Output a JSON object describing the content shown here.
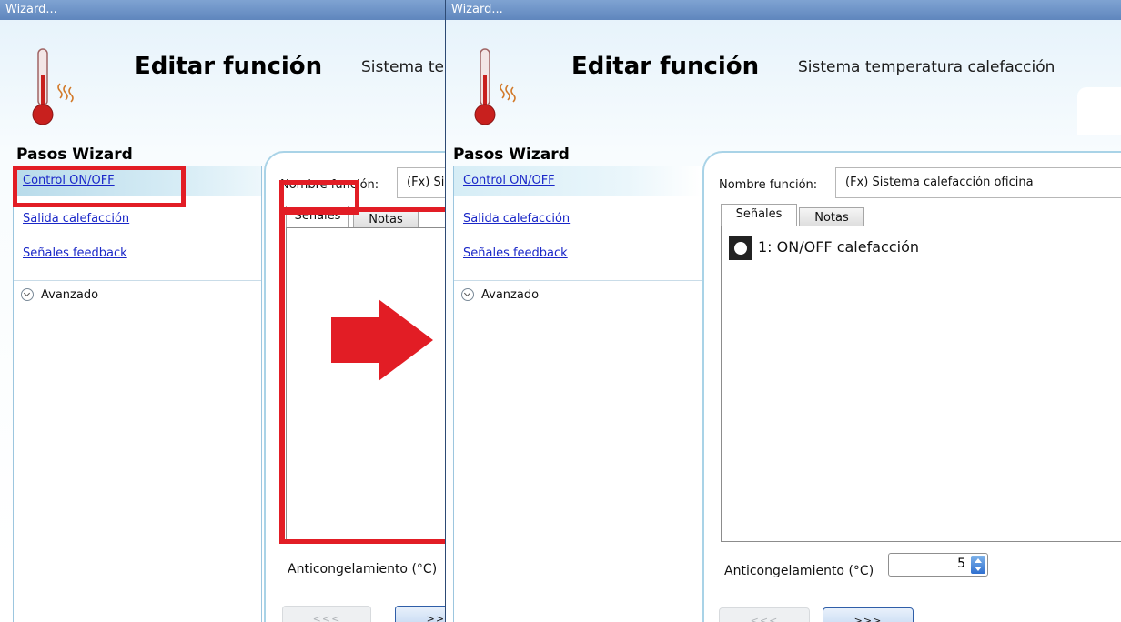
{
  "windows": [
    {
      "title": "Wizard...",
      "header": {
        "title": "Editar función",
        "subtitle": "Sistema te"
      },
      "steps_title": "Pasos Wizard",
      "steps": [
        {
          "label": "Control ON/OFF",
          "selected": true
        },
        {
          "label": "Salida calefacción",
          "selected": false
        },
        {
          "label": "Señales feedback",
          "selected": false
        }
      ],
      "advanced_label": "Avanzado",
      "function_name_label": "Nombre función:",
      "function_name_value": "(Fx) Si",
      "tabs": [
        "Señales",
        "Notas"
      ],
      "signals": [],
      "antifreeze_label": "Anticongelamiento (°C)",
      "prev_button": "<<<",
      "next_button": ">>>"
    },
    {
      "title": "Wizard...",
      "header": {
        "title": "Editar función",
        "subtitle": "Sistema temperatura calefacción"
      },
      "steps_title": "Pasos Wizard",
      "steps": [
        {
          "label": "Control ON/OFF",
          "selected": false
        },
        {
          "label": "Salida calefacción",
          "selected": false
        },
        {
          "label": "Señales feedback",
          "selected": false
        }
      ],
      "advanced_label": "Avanzado",
      "function_name_label": "Nombre función:",
      "function_name_value": "(Fx) Sistema calefacción oficina",
      "tabs": [
        "Señales",
        "Notas"
      ],
      "signals": [
        "1: ON/OFF calefacción"
      ],
      "antifreeze_label": "Anticongelamiento (°C)",
      "antifreeze_value": "5",
      "prev_button": "<<<",
      "next_button": ">>>"
    }
  ],
  "colors": {
    "highlight": "#e21d25",
    "titlebar": "#6f95c8",
    "link": "#1a27c8"
  }
}
